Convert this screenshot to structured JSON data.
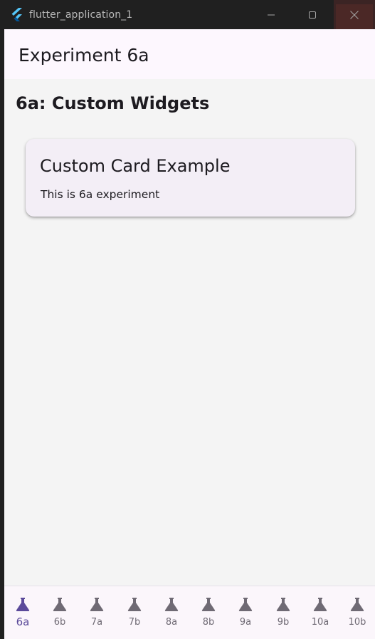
{
  "window": {
    "title": "flutter_application_1",
    "controls": [
      "minimize",
      "maximize",
      "close"
    ]
  },
  "appbar": {
    "title": "Experiment 6a"
  },
  "page": {
    "heading": "6a: Custom Widgets",
    "card": {
      "title": "Custom Card Example",
      "body": "This is 6a experiment"
    }
  },
  "nav": {
    "selected": "6a",
    "icon": "flask-icon",
    "colors": {
      "selected": "#5b4a9a",
      "unselected": "#6f6a74"
    },
    "items": [
      {
        "label": "6a"
      },
      {
        "label": "6b"
      },
      {
        "label": "7a"
      },
      {
        "label": "7b"
      },
      {
        "label": "8a"
      },
      {
        "label": "8b"
      },
      {
        "label": "9a"
      },
      {
        "label": "9b"
      },
      {
        "label": "10a"
      },
      {
        "label": "10b"
      }
    ]
  }
}
